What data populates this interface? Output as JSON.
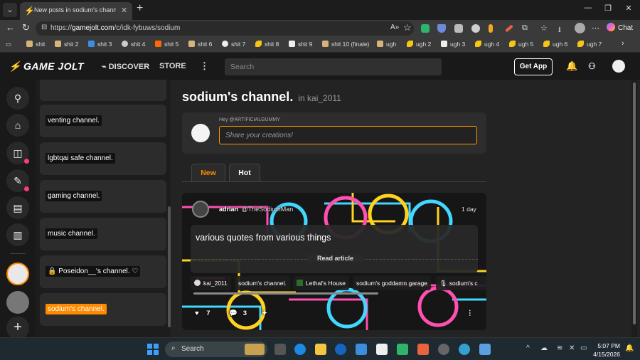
{
  "browser": {
    "active_tab_title": "New posts in sodium's channel. - i",
    "tab_favicon": "gamejolt-bolt-icon",
    "url_prefix": "https://",
    "url_host": "gamejolt.com",
    "url_path": "/c/idk-fybuws/sodium",
    "copilot_label": "Chat"
  },
  "bookmarks": [
    {
      "label": "shit",
      "color": "#d7b27a"
    },
    {
      "label": "shit 2",
      "color": "#d7b27a"
    },
    {
      "label": "shit 3",
      "color": "#3a8ee6"
    },
    {
      "label": "shit 4",
      "color": "#cccccc"
    },
    {
      "label": "shit 5",
      "color": "#ff6a00"
    },
    {
      "label": "shit 6",
      "color": "#d7b27a"
    },
    {
      "label": "shit 7",
      "color": "#eeeeee"
    },
    {
      "label": "shit 8",
      "color": "#f5c518"
    },
    {
      "label": "shit 9",
      "color": "#eeeeee"
    },
    {
      "label": "shit 10 (finale)",
      "color": "#d7b27a"
    },
    {
      "label": "ugh",
      "color": "#d7b27a"
    },
    {
      "label": "ugh 2",
      "color": "#f5c518"
    },
    {
      "label": "ugh 3",
      "color": "#eeeeee"
    },
    {
      "label": "ugh 4",
      "color": "#f5c518"
    },
    {
      "label": "ugh 5",
      "color": "#f5c518"
    },
    {
      "label": "ugh 6",
      "color": "#f5c518"
    },
    {
      "label": "ugh 7",
      "color": "#f5c518"
    }
  ],
  "gj": {
    "logo": "GAME JOLT",
    "discover": "DISCOVER",
    "store": "STORE",
    "search_placeholder": "Search",
    "get_app": "Get App"
  },
  "channels": [
    {
      "label": "venting channel.",
      "active": false
    },
    {
      "label": "lgbtqai safe channel.",
      "active": false
    },
    {
      "label": "gaming channel.",
      "active": false
    },
    {
      "label": "music channel.",
      "active": false
    },
    {
      "label": "🔒 Poseidon__'s channel. ♡",
      "active": false
    },
    {
      "label": "sodium's channel.",
      "active": true
    }
  ],
  "channel": {
    "title": "sodium's channel.",
    "in_label": "in kai_2011",
    "greeting": "Hey @ARTIFICIALGUMMY",
    "composer_placeholder": "Share your creations!",
    "tabs": [
      "New",
      "Hot"
    ]
  },
  "post": {
    "author_name": "adrian",
    "author_handle": "@TheSodiumMan",
    "time": "1 day",
    "text": "various quotes from various things",
    "read_label": "Read article",
    "tags": [
      "kai_2011",
      "sodium's channel.",
      "Lethal's House",
      "sodium's goddamn garage",
      "sodium's c"
    ],
    "likes": "7",
    "comments": "3"
  },
  "taskbar": {
    "search_label": "Search",
    "time": "5:07 PM",
    "date": "4/15/2026"
  },
  "colors": {
    "accent": "#ff8a00",
    "brand_pink": "#ff3fac",
    "notification_dot": "#ff3c7a"
  }
}
